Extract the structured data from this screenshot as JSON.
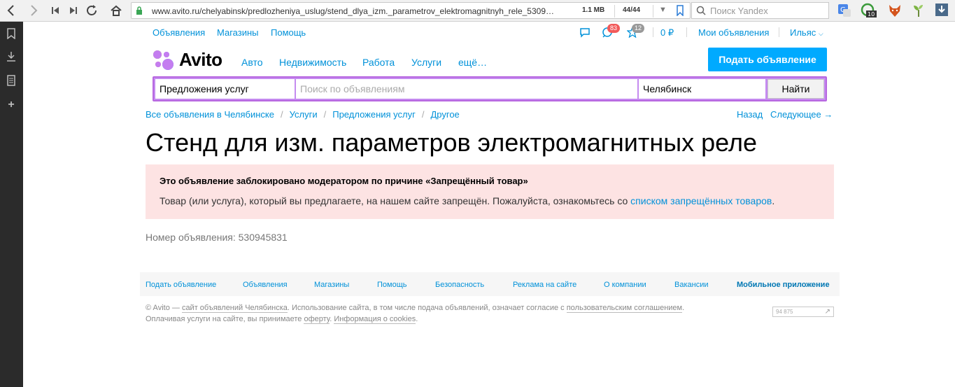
{
  "browser": {
    "url": "www.avito.ru/chelyabinsk/predlozheniya_uslug/stend_dlya_izm._parametrov_elektromagnitnyh_rele_5309…",
    "size": "1.1 MB",
    "count": "44/44",
    "search_placeholder": "Поиск Yandex",
    "ext_badge": "10"
  },
  "topnav": {
    "ads": "Объявления",
    "shops": "Магазины",
    "help": "Помощь",
    "messages_badge": "83",
    "favorites_badge": "12",
    "balance": "0 ₽",
    "my_ads": "Мои объявления",
    "user": "Ильяс"
  },
  "header": {
    "logo": "Avito",
    "nav": [
      "Авто",
      "Недвижимость",
      "Работа",
      "Услуги",
      "ещё…"
    ],
    "post_button": "Подать объявление"
  },
  "search": {
    "category": "Предложения услуг",
    "query_placeholder": "Поиск по объявлениям",
    "city": "Челябинск",
    "button": "Найти"
  },
  "breadcrumbs": [
    "Все объявления в Челябинске",
    "Услуги",
    "Предложения услуг",
    "Другое"
  ],
  "pager": {
    "back": "Назад",
    "next": "Следующее →"
  },
  "title": "Стенд для изм. параметров электромагнитных реле",
  "alert": {
    "heading": "Это объявление заблокировано модератором по причине «Запрещённый товар»",
    "body": "Товар (или услуга), который вы предлагаете, на нашем сайте запрещён. Пожалуйста, ознакомьтесь со ",
    "link": "списком запрещённых товаров",
    "tail": "."
  },
  "ad_number": "Номер объявления: 530945831",
  "footer": {
    "links": [
      "Подать объявление",
      "Объявления",
      "Магазины",
      "Помощь",
      "Безопасность",
      "Реклама на сайте",
      "О компании",
      "Вакансии",
      "Мобильное приложение"
    ],
    "line1_a": "© Avito — ",
    "line1_link1": "сайт объявлений Челябинска",
    "line1_b": ". Использование сайта, в том числе подача объявлений, означает согласие с ",
    "line1_link2": "пользовательским соглашением",
    "line1_c": ".",
    "line2_a": "Оплачивая услуги на сайте, вы принимаете ",
    "line2_link1": "оферту",
    "line2_b": ". ",
    "line2_link2": "Информация о cookies",
    "line2_c": ".",
    "counter": "94 875"
  },
  "colors": {
    "link": "#0091d9",
    "post_button": "#00aaff",
    "search_border": "#b767e0",
    "alert_bg": "#fde3e3"
  }
}
